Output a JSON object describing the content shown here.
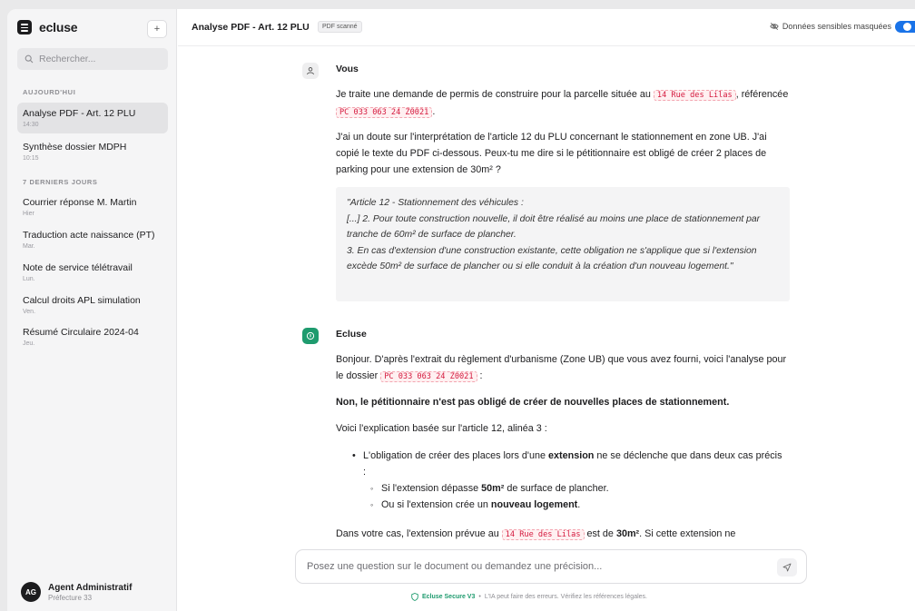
{
  "brand": {
    "name": "ecluse",
    "new_label": "+"
  },
  "search": {
    "placeholder": "Rechercher..."
  },
  "sidebar": {
    "sections": [
      {
        "label": "AUJOURD'HUI"
      },
      {
        "label": "7 DERNIERS JOURS"
      }
    ],
    "items": [
      {
        "title": "Analyse PDF - Art. 12 PLU",
        "time": "14:30"
      },
      {
        "title": "Synthèse dossier MDPH",
        "time": "10:15"
      },
      {
        "title": "Courrier réponse M. Martin",
        "time": "Hier"
      },
      {
        "title": "Traduction acte naissance (PT)",
        "time": "Mar."
      },
      {
        "title": "Note de service télétravail",
        "time": "Lun."
      },
      {
        "title": "Calcul droits APL simulation",
        "time": "Ven."
      },
      {
        "title": "Résumé Circulaire 2024-04",
        "time": "Jeu."
      }
    ],
    "user": {
      "initials": "AG",
      "name": "Agent Administratif",
      "org": "Préfecture 33"
    }
  },
  "header": {
    "title": "Analyse PDF - Art. 12 PLU",
    "badge": "PDF scanné",
    "mask_label": "Données sensibles masquées",
    "mask_enabled": true
  },
  "messages": {
    "user": {
      "author": "Vous",
      "p1_a": "Je traite une demande de permis de construire pour la parcelle située au ",
      "p1_code1": "14 Rue des Lilas",
      "p1_b": ", référencée ",
      "p1_code2": "PC 033 063 24 Z0021",
      "p1_c": ".",
      "p2": "J'ai un doute sur l'interprétation de l'article 12 du PLU concernant le stationnement en zone UB. J'ai copié le texte du PDF ci-dessous. Peux-tu me dire si le pétitionnaire est obligé de créer 2 places de parking pour une extension de 30m² ?",
      "quote": "\"Article 12 - Stationnement des véhicules :\n[...] 2. Pour toute construction nouvelle, il doit être réalisé au moins une place de stationnement par tranche de 60m² de surface de plancher.\n3. En cas d'extension d'une construction existante, cette obligation ne s'applique que si l'extension excède 50m² de surface de plancher ou si elle conduit à la création d'un nouveau logement.\""
    },
    "assistant": {
      "author": "Ecluse",
      "p1_a": "Bonjour. D'après l'extrait du règlement d'urbanisme (Zone UB) que vous avez fourni, voici l'analyse pour le dossier ",
      "p1_code": "PC 033 063 24 Z0021",
      "p1_b": " :",
      "p2_bold": "Non, le pétitionnaire n'est pas obligé de créer de nouvelles places de stationnement.",
      "p3": "Voici l'explication basée sur l'article 12, alinéa 3 :",
      "bullet_a": "L'obligation de créer des places lors d'une ",
      "bullet_bold": "extension",
      "bullet_b": " ne se déclenche que dans deux cas précis :",
      "sub1_a": "Si l'extension dépasse ",
      "sub1_bold": "50m²",
      "sub1_b": " de surface de plancher.",
      "sub2_a": "Ou si l'extension crée un ",
      "sub2_bold": "nouveau logement",
      "sub2_b": ".",
      "p4_a": "Dans votre cas, l'extension prévue au ",
      "p4_code": "14 Rue des Lilas",
      "p4_b": " est de ",
      "p4_bold": "30m²",
      "p4_c": ". Si cette extension ne"
    }
  },
  "composer": {
    "placeholder": "Posez une question sur le document ou demandez une précision..."
  },
  "footer": {
    "secure": "Ecluse Secure V3",
    "sep": "•",
    "note": "L'IA peut faire des erreurs. Vérifiez les références légales."
  },
  "colors": {
    "accent": "#1a73e8",
    "brand_green": "#1e9b6e",
    "code_red": "#d4183d"
  }
}
